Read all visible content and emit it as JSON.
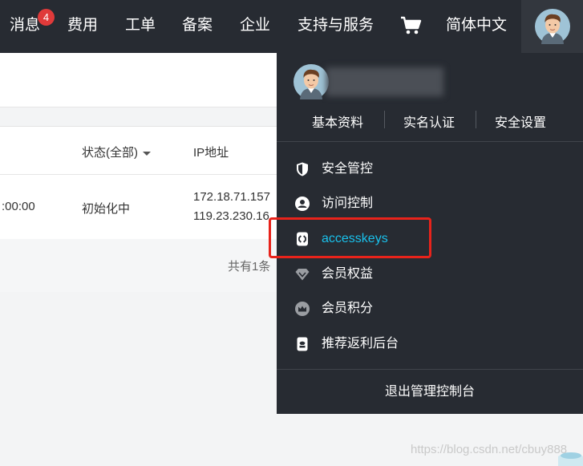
{
  "topbar": {
    "nav": [
      "消息",
      "费用",
      "工单",
      "备案",
      "企业",
      "支持与服务",
      "简体中文"
    ],
    "message_badge": "4",
    "cart_icon": "cart-icon"
  },
  "table": {
    "headers": {
      "status": "状态(全部)",
      "ip": "IP地址"
    },
    "row": {
      "time": ":00:00",
      "status": "初始化中",
      "ip1": "172.18.71.157",
      "ip2": "119.23.230.16"
    },
    "pager": "共有1条"
  },
  "dropdown": {
    "links": [
      "基本资料",
      "实名认证",
      "安全设置"
    ],
    "menu": [
      {
        "label": "安全管控",
        "icon": "shield-icon"
      },
      {
        "label": "访问控制",
        "icon": "user-circle-icon"
      },
      {
        "label": "accesskeys",
        "icon": "accesskeys-icon",
        "active": true
      },
      {
        "label": "会员权益",
        "icon": "diamond-icon"
      },
      {
        "label": "会员积分",
        "icon": "crown-icon"
      },
      {
        "label": "推荐返利后台",
        "icon": "document-icon"
      }
    ],
    "logout": "退出管理控制台"
  },
  "watermark": "https://blog.csdn.net/cbuy888",
  "colors": {
    "topbar": "#272b32",
    "accent": "#19c1ec",
    "highlight": "#e8231b",
    "badge": "#e03a3a"
  }
}
